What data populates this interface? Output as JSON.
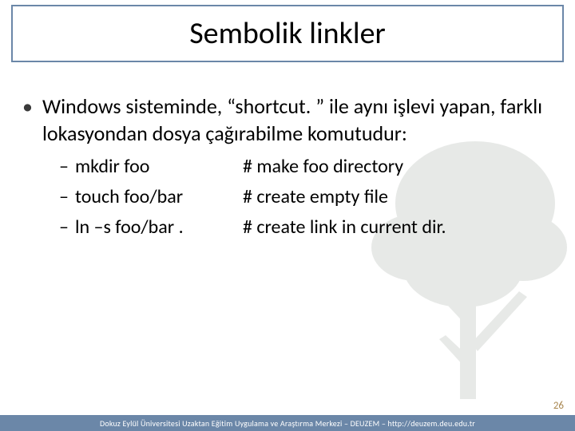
{
  "title": "Sembolik linkler",
  "bullet_l1": "Windows sisteminde,  “shortcut. ” ile aynı işlevi yapan, farklı lokasyondan dosya çağırabilme komutudur:",
  "sub_items": [
    {
      "cmd": "mkdir foo",
      "comment": "# make foo directory"
    },
    {
      "cmd": "touch foo/bar",
      "comment": "  # create empty file"
    },
    {
      "cmd": "ln –s foo/bar .",
      "comment": "  # create link in current dir."
    }
  ],
  "page_number": "26",
  "footer": "Dokuz Eylül Üniversitesi Uzaktan Eğitim Uygulama ve Araştırma Merkezi – DEUZEM – http://deuzem.deu.edu.tr",
  "colors": {
    "accent": "#6b87a8",
    "page_num": "#a8864f"
  }
}
